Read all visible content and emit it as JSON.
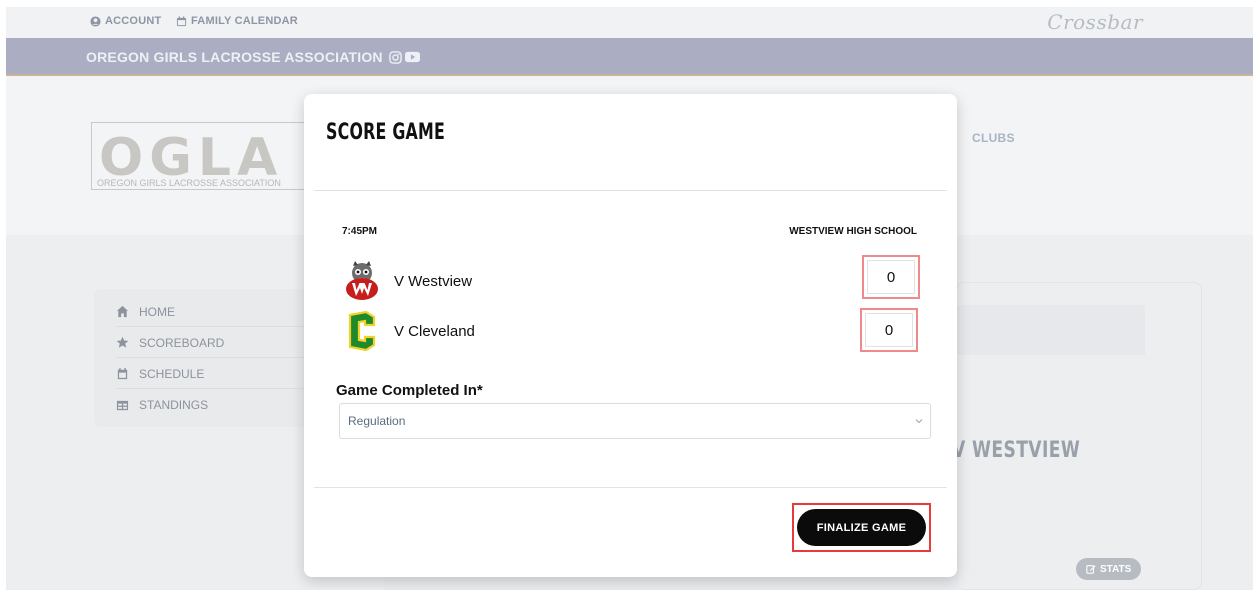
{
  "topbar": {
    "account_label": "ACCOUNT",
    "calendar_label": "FAMILY CALENDAR",
    "brand": "Crossbar"
  },
  "org": {
    "name": "OREGON GIRLS LACROSSE ASSOCIATION",
    "logo_letters": "OGLA",
    "logo_subtitle": "OREGON GIRLS LACROSSE ASSOCIATION"
  },
  "nav": {
    "clubs_label": "CLUBS",
    "items": [
      {
        "label": "HOME",
        "icon": "home-icon"
      },
      {
        "label": "SCOREBOARD",
        "icon": "star-icon"
      },
      {
        "label": "SCHEDULE",
        "icon": "calendar-icon"
      },
      {
        "label": "STANDINGS",
        "icon": "table-icon"
      }
    ]
  },
  "background": {
    "game_heading": "V WESTVIEW",
    "stats_label": "STATS"
  },
  "modal": {
    "title": "SCORE GAME",
    "time": "7:45PM",
    "venue": "WESTVIEW HIGH SCHOOL",
    "teams": [
      {
        "name": "V Westview",
        "score": "0",
        "logo": "westview-wildcat-logo"
      },
      {
        "name": "V Cleveland",
        "score": "0",
        "logo": "cleveland-c-logo"
      }
    ],
    "completed_label": "Game Completed In*",
    "completed_value": "Regulation",
    "finalize_label": "FINALIZE GAME"
  },
  "colors": {
    "accent_red": "#e53b3b",
    "score_outline": "#f08a8a",
    "button_bg": "#0b0b0b",
    "orgbar_bg": "#abaec3"
  }
}
